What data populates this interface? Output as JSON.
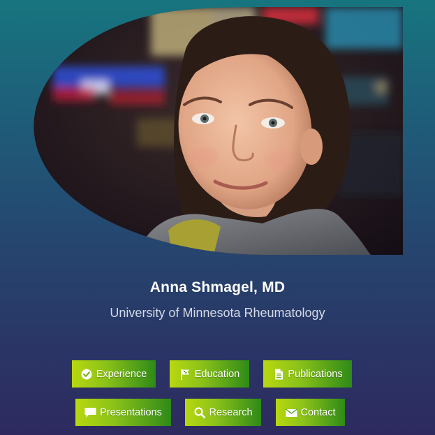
{
  "profile": {
    "name": "Anna Shmagel, MD",
    "affiliation": "University of Minnesota Rheumatology",
    "photo_icon": "profile-photo"
  },
  "nav": {
    "experience": {
      "label": "Experience",
      "icon": "check-circle-icon"
    },
    "education": {
      "label": "Education",
      "icon": "flag-icon"
    },
    "publications": {
      "label": "Publications",
      "icon": "document-icon"
    },
    "presentations": {
      "label": "Presentations",
      "icon": "speech-bubble-icon"
    },
    "research": {
      "label": "Research",
      "icon": "search-icon"
    },
    "contact": {
      "label": "Contact",
      "icon": "envelope-icon"
    }
  },
  "colors": {
    "background_top": "#17757f",
    "background_bottom": "#2e2a5f",
    "button_start": "#b8d80f",
    "button_end": "#2e8a18"
  }
}
